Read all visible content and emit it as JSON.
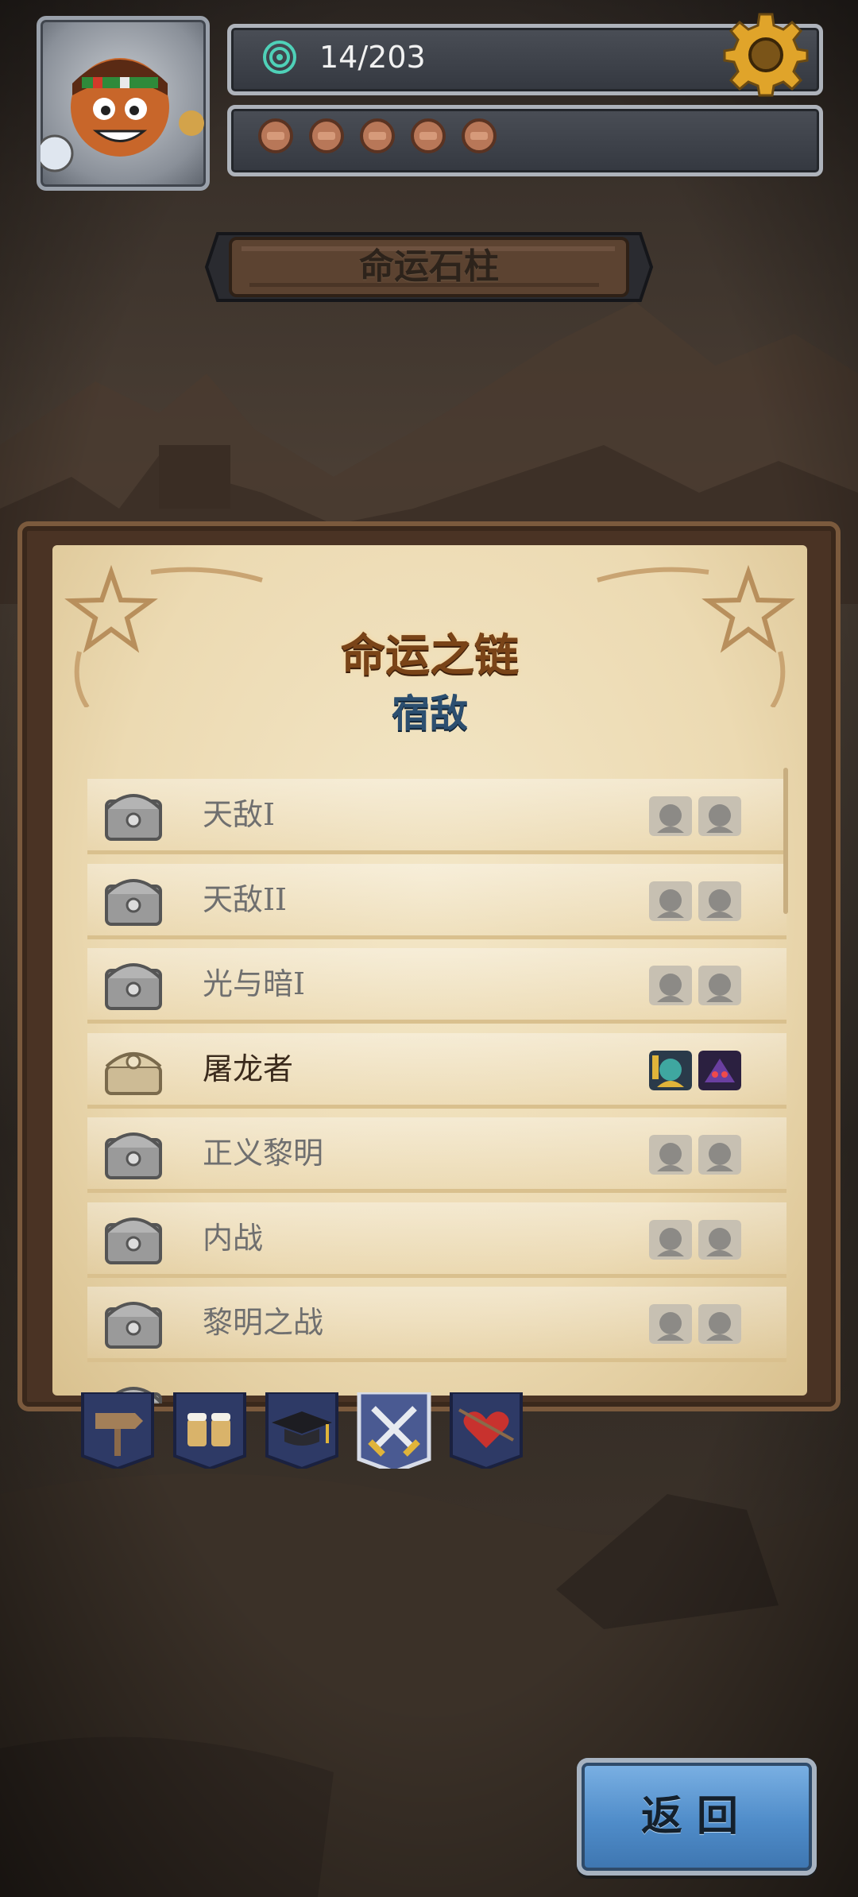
{
  "header": {
    "progress_counter": "14/203",
    "scroll_count": 5,
    "avatar": "hero-portrait",
    "currency_icon": "spiral-icon",
    "settings_icon": "gear-icon"
  },
  "location_title": "命运石柱",
  "panel": {
    "title": "命运之链",
    "subtitle": "宿敌",
    "items": [
      {
        "name": "天敌I",
        "unlocked": false
      },
      {
        "name": "天敌II",
        "unlocked": false
      },
      {
        "name": "光与暗I",
        "unlocked": false
      },
      {
        "name": "屠龙者",
        "unlocked": true
      },
      {
        "name": "正义黎明",
        "unlocked": false
      },
      {
        "name": "内战",
        "unlocked": false
      },
      {
        "name": "黎明之战",
        "unlocked": false
      }
    ]
  },
  "tabs": [
    {
      "icon": "signpost-icon",
      "active": false
    },
    {
      "icon": "beer-mugs-icon",
      "active": false
    },
    {
      "icon": "graduation-cap-icon",
      "active": false
    },
    {
      "icon": "crossed-swords-icon",
      "active": true
    },
    {
      "icon": "heart-arrow-icon",
      "active": false
    }
  ],
  "back_button": {
    "label": "返回"
  },
  "colors": {
    "panel_title": "#7a4418",
    "panel_subtitle": "#2c4f70",
    "back_button": "#4f8cc9"
  }
}
